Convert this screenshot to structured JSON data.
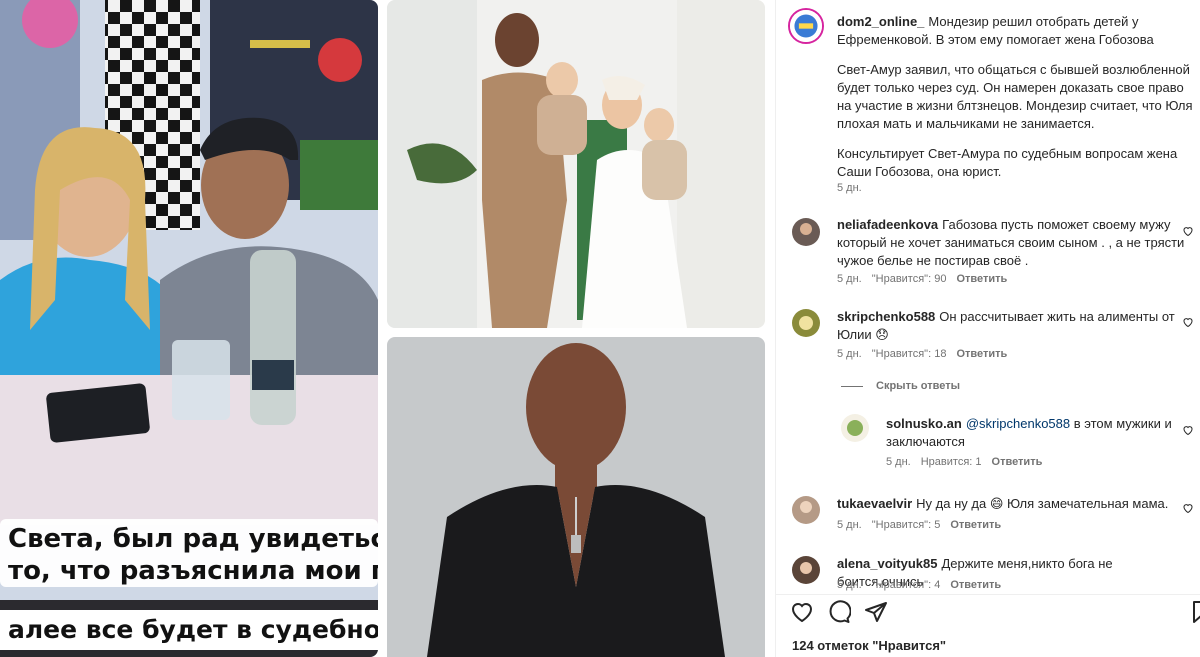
{
  "photo1": {
    "caption_line1": "Света, был рад увидеться, спасибо за",
    "caption_line2": "то, что разъяснила мои права 😉 ✊",
    "caption_line3": "алее все будет в судебном порядке"
  },
  "post": {
    "author": "dom2_online_",
    "caption_lead": "Мондезир решил отобрать детей у Ефременковой. В этом ему помогает жена Гобозова",
    "caption_p2": "Свет-Амур заявил, что общаться с бывшей возлюбленной будет только через суд. Он намерен доказать свое право на участие в жизни блтзнецов. Мондезир считает, что Юля плохая мать и мальчиками не занимается.",
    "caption_p3": "Консультирует Свет-Амура по судебным вопросам жена Саши Гобозова, она юрист.",
    "time": "5 дн."
  },
  "comments": [
    {
      "user": "neliafadeenkova",
      "text": "Габозова пусть поможет своему мужу который не хочет заниматься своим сыном . , а не трясти чужое белье не постирав своё .",
      "time": "5 дн.",
      "likes": "\"Нравится\": 90",
      "reply": "Ответить"
    },
    {
      "user": "skripchenko588",
      "text": "Он рассчитывает жить на алименты от Юлии 😞",
      "time": "5 дн.",
      "likes": "\"Нравится\": 18",
      "reply": "Ответить",
      "hide_replies": "Скрыть ответы"
    },
    {
      "user": "solnusko.an",
      "mention": "@skripchenko588",
      "text": "в этом мужики и заключаются",
      "time": "5 дн.",
      "likes": "Нравится: 1",
      "reply": "Ответить"
    },
    {
      "user": "tukaevaelvir",
      "text": "Ну да ну да 😄 Юля замечательная мама.",
      "time": "5 дн.",
      "likes": "\"Нравится\": 5",
      "reply": "Ответить"
    },
    {
      "user": "alena_voityuk85",
      "text": "Держите меня,никто бога не боится,очнись",
      "time": "5 дн.",
      "likes": "\"Нравится\": 4",
      "reply": "Ответить"
    }
  ],
  "footer": {
    "likes_count": "124 отметок \"Нравится\""
  },
  "icons": [
    "heart-icon",
    "comment-icon",
    "share-icon",
    "bookmark-icon"
  ],
  "colors": {
    "link": "#00376b",
    "meta": "#737373",
    "text": "#262626"
  }
}
